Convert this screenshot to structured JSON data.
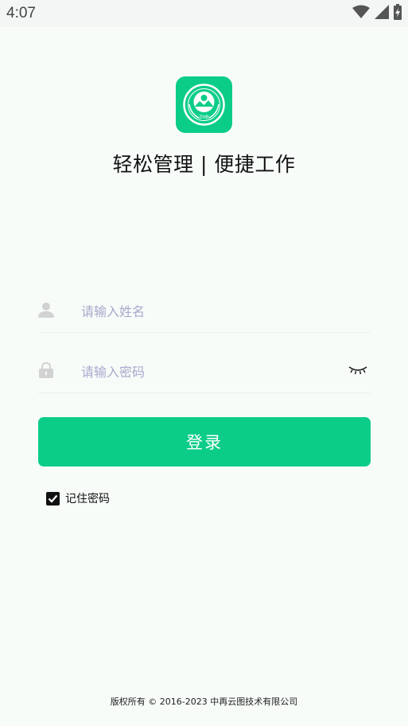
{
  "status_bar": {
    "time": "4:07",
    "icons": [
      "wifi-icon",
      "cellular-signal-icon",
      "battery-charging-icon"
    ]
  },
  "logo": {
    "icon": "environmental-emblem-icon",
    "emblem_text": "ZHB",
    "color": "#0ccd88"
  },
  "tagline": "轻松管理 | 便捷工作",
  "form": {
    "name_placeholder": "请输入姓名",
    "name_value": "",
    "password_placeholder": "请输入密码",
    "password_value": "",
    "user_icon": "user-icon",
    "lock_icon": "lock-icon",
    "visibility_icon": "eye-closed-icon"
  },
  "login_button": "登录",
  "remember": {
    "label": "记住密码",
    "checked": true
  },
  "footer": "版权所有 © 2016-2023 中再云图技术有限公司",
  "colors": {
    "accent": "#0ccd88",
    "background": "#f7fcf9",
    "placeholder": "#a9a9cc"
  }
}
